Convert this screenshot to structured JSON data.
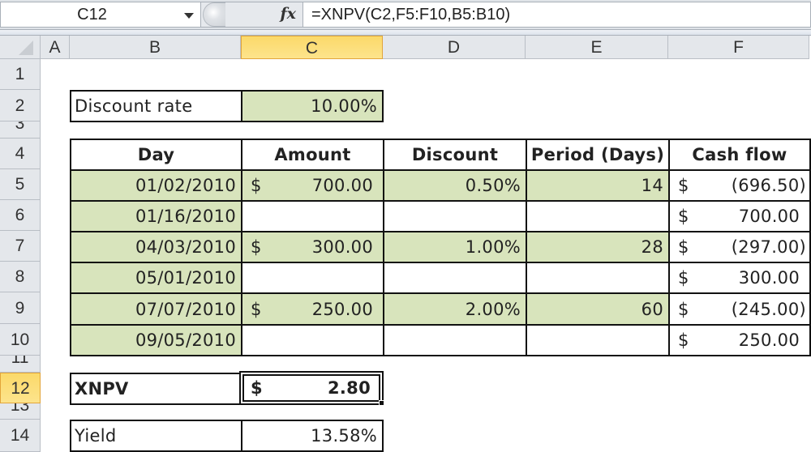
{
  "formula_bar": {
    "name_box": "C12",
    "fx_label": "fx",
    "formula": "=XNPV(C2,F5:F10,B5:B10)"
  },
  "columns": [
    "A",
    "B",
    "C",
    "D",
    "E",
    "F"
  ],
  "selected_column": "C",
  "rows": [
    "1",
    "2",
    "3",
    "4",
    "5",
    "6",
    "7",
    "8",
    "9",
    "10",
    "11",
    "12",
    "13",
    "14"
  ],
  "selected_row": "12",
  "discount_rate": {
    "label": "Discount rate",
    "value": "10.00%"
  },
  "table": {
    "headers": [
      "Day",
      "Amount",
      "Discount",
      "Period (Days)",
      "Cash flow"
    ],
    "rows": [
      {
        "day": "01/02/2010",
        "amount_sym": "$",
        "amount": "700.00",
        "discount": "0.50%",
        "period": "14",
        "cf_sym": "$",
        "cash_flow": "(696.50)"
      },
      {
        "day": "01/16/2010",
        "amount_sym": "",
        "amount": "",
        "discount": "",
        "period": "",
        "cf_sym": "$",
        "cash_flow": "700.00 "
      },
      {
        "day": "04/03/2010",
        "amount_sym": "$",
        "amount": "300.00",
        "discount": "1.00%",
        "period": "28",
        "cf_sym": "$",
        "cash_flow": "(297.00)"
      },
      {
        "day": "05/01/2010",
        "amount_sym": "",
        "amount": "",
        "discount": "",
        "period": "",
        "cf_sym": "$",
        "cash_flow": "300.00 "
      },
      {
        "day": "07/07/2010",
        "amount_sym": "$",
        "amount": "250.00",
        "discount": "2.00%",
        "period": "60",
        "cf_sym": "$",
        "cash_flow": "(245.00)"
      },
      {
        "day": "09/05/2010",
        "amount_sym": "",
        "amount": "",
        "discount": "",
        "period": "",
        "cf_sym": "$",
        "cash_flow": "250.00 "
      }
    ]
  },
  "xnpv": {
    "label": "XNPV",
    "symbol": "$",
    "value": "2.80"
  },
  "yield": {
    "label": "Yield",
    "value": "13.58%"
  },
  "colors": {
    "input_fill": "#d8e4bc",
    "selection_header": "#fbd96a"
  }
}
